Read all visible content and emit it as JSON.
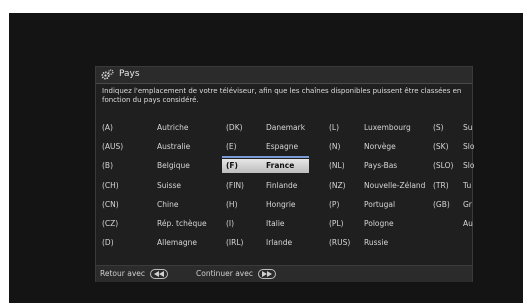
{
  "header": {
    "title": "Pays"
  },
  "description": "Indiquez l'emplacement de votre téléviseur, afin que les chaînes disponibles puissent être classées en fonction du pays considéré.",
  "countries": [
    [
      {
        "code": "(A)",
        "name": "Autriche"
      },
      {
        "code": "(AUS)",
        "name": "Australie"
      },
      {
        "code": "(B)",
        "name": "Belgique"
      },
      {
        "code": "(CH)",
        "name": "Suisse"
      },
      {
        "code": "(CN)",
        "name": "Chine"
      },
      {
        "code": "(CZ)",
        "name": "Rép. tchèque"
      },
      {
        "code": "(D)",
        "name": "Allemagne"
      }
    ],
    [
      {
        "code": "(DK)",
        "name": "Danemark"
      },
      {
        "code": "(E)",
        "name": "Espagne"
      },
      {
        "code": "(F)",
        "name": "France"
      },
      {
        "code": "(FIN)",
        "name": "Finlande"
      },
      {
        "code": "(H)",
        "name": "Hongrie"
      },
      {
        "code": "(I)",
        "name": "Italie"
      },
      {
        "code": "(IRL)",
        "name": "Irlande"
      }
    ],
    [
      {
        "code": "(L)",
        "name": "Luxembourg"
      },
      {
        "code": "(N)",
        "name": "Norvège"
      },
      {
        "code": "(NL)",
        "name": "Pays-Bas"
      },
      {
        "code": "(NZ)",
        "name": "Nouvelle-Zéland"
      },
      {
        "code": "(P)",
        "name": "Portugal"
      },
      {
        "code": "(PL)",
        "name": "Pologne"
      },
      {
        "code": "(RUS)",
        "name": "Russie"
      }
    ],
    [
      {
        "code": "(S)",
        "name": "Su"
      },
      {
        "code": "(SK)",
        "name": "Slo"
      },
      {
        "code": "(SLO)",
        "name": "Slo"
      },
      {
        "code": "(TR)",
        "name": "Tu"
      },
      {
        "code": "(GB)",
        "name": "Gr"
      },
      {
        "code": "",
        "name": "Au"
      }
    ]
  ],
  "selected": "(F)",
  "footer": {
    "back_label": "Retour avec",
    "back_key_icon": "rewind-key-icon",
    "continue_label": "Continuer avec",
    "continue_key_icon": "fast-forward-key-icon"
  },
  "colors": {
    "selection": "#d9d9d9",
    "background": "#141414"
  }
}
